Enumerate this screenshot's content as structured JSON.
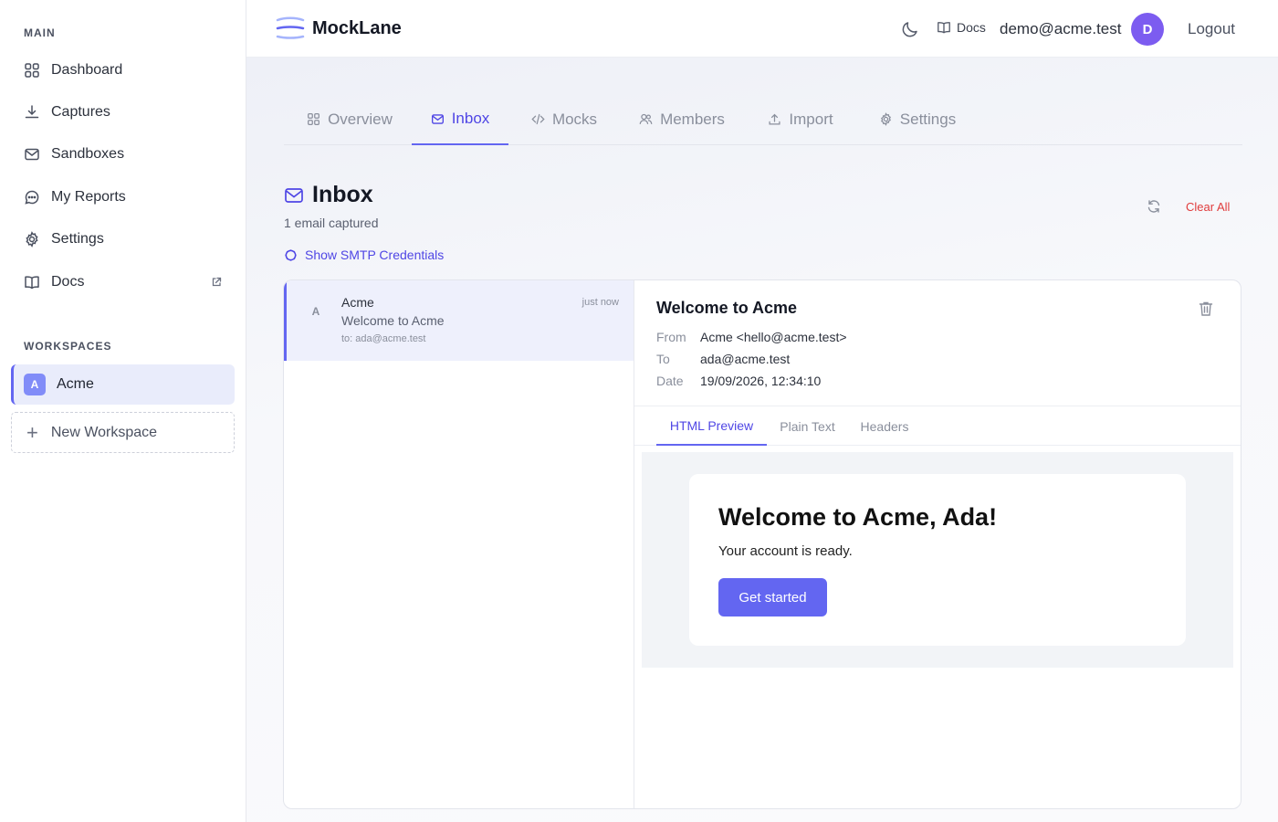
{
  "sidebar": {
    "main_section": "MAIN",
    "items": [
      {
        "label": "Dashboard",
        "icon": "grid-icon"
      },
      {
        "label": "Captures",
        "icon": "download-icon"
      },
      {
        "label": "Sandboxes",
        "icon": "mail-icon"
      },
      {
        "label": "My Reports",
        "icon": "chat-icon"
      },
      {
        "label": "Settings",
        "icon": "gear-icon"
      },
      {
        "label": "Docs",
        "icon": "book-icon"
      }
    ],
    "workspaces_section": "WORKSPACES",
    "workspace": {
      "badge": "A",
      "label": "Acme"
    },
    "new_workspace": "New Workspace"
  },
  "topbar": {
    "brand": "MockLane",
    "docs": "Docs",
    "user_email": "demo@acme.test",
    "avatar_initial": "D",
    "logout": "Logout"
  },
  "tabs": [
    {
      "label": "Overview"
    },
    {
      "label": "Inbox",
      "active": true
    },
    {
      "label": "Mocks"
    },
    {
      "label": "Members"
    },
    {
      "label": "Import"
    },
    {
      "label": "Settings"
    }
  ],
  "inbox": {
    "title": "Inbox",
    "count": "1 email captured",
    "smtp_toggle": "Show SMTP Credentials",
    "clear_all": "Clear All"
  },
  "emails": [
    {
      "avatar": "A",
      "from": "Acme",
      "subject": "Welcome to Acme",
      "to": "to: ada@acme.test",
      "time": "just now"
    }
  ],
  "detail": {
    "subject": "Welcome to Acme",
    "meta": [
      {
        "key": "From",
        "value": "Acme <hello@acme.test>"
      },
      {
        "key": "To",
        "value": "ada@acme.test"
      },
      {
        "key": "Date",
        "value": "19/09/2026, 12:34:10"
      }
    ],
    "tabs": [
      "HTML Preview",
      "Plain Text",
      "Headers"
    ],
    "active_tab": "HTML Preview",
    "preview": {
      "heading": "Welcome to Acme, Ada!",
      "body": "Your account is ready.",
      "button": "Get started"
    }
  },
  "colors": {
    "accent": "#6366f1",
    "accent_text": "#4f46e5",
    "danger": "#e03b3b",
    "avatar": "#7c5cf0"
  }
}
